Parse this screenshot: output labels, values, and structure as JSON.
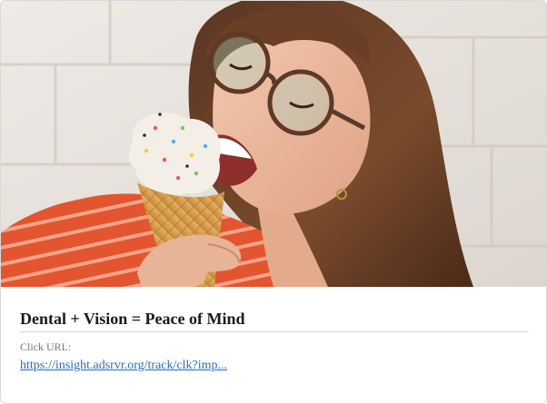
{
  "ad": {
    "headline": "Dental + Vision = Peace of Mind",
    "click_url_label": "Click URL:",
    "click_url": "https://insight.adsrvr.org/track/clk?imp..."
  },
  "image": {
    "subject": "woman-with-glasses-eating-ice-cream-cone-photo"
  },
  "colors": {
    "link": "#2a6db8",
    "headline": "#1a1a1a",
    "divider": "#d6d6d6",
    "label": "#777777"
  }
}
